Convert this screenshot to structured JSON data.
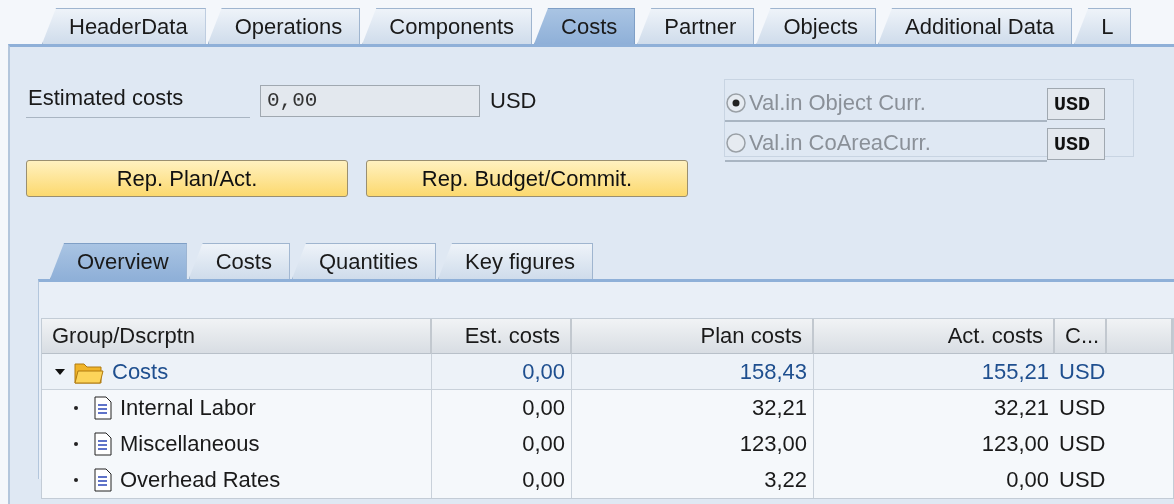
{
  "tabs": [
    {
      "label": "HeaderData",
      "selected": false
    },
    {
      "label": "Operations",
      "selected": false
    },
    {
      "label": "Components",
      "selected": false
    },
    {
      "label": "Costs",
      "selected": true
    },
    {
      "label": "Partner",
      "selected": false
    },
    {
      "label": "Objects",
      "selected": false
    },
    {
      "label": "Additional Data",
      "selected": false
    },
    {
      "label": "L",
      "selected": false
    }
  ],
  "estimated_costs": {
    "label": "Estimated costs",
    "value": "0,00",
    "currency": "USD"
  },
  "valuation": [
    {
      "label": "Val.in Object Curr.",
      "selected": true,
      "disabled": true,
      "currency": "USD"
    },
    {
      "label": "Val.in CoAreaCurr.",
      "selected": false,
      "disabled": true,
      "currency": "USD"
    }
  ],
  "buttons": [
    "Rep. Plan/Act.",
    "Rep. Budget/Commit."
  ],
  "subtabs": [
    {
      "label": "Overview",
      "selected": true
    },
    {
      "label": "Costs",
      "selected": false
    },
    {
      "label": "Quantities",
      "selected": false
    },
    {
      "label": "Key figures",
      "selected": false
    }
  ],
  "table": {
    "columns": [
      "Group/Dscrptn",
      "Est. costs",
      "Plan costs",
      "Act. costs",
      "C..."
    ],
    "rows": [
      {
        "label": "Costs",
        "expanded": true,
        "est": "0,00",
        "plan": "158,43",
        "act": "155,21",
        "currency": "USD",
        "children": [
          {
            "label": "Internal Labor",
            "est": "0,00",
            "plan": "32,21",
            "act": "32,21",
            "currency": "USD"
          },
          {
            "label": "Miscellaneous",
            "est": "0,00",
            "plan": "123,00",
            "act": "123,00",
            "currency": "USD"
          },
          {
            "label": "Overhead Rates",
            "est": "0,00",
            "plan": "3,22",
            "act": "0,00",
            "currency": "USD"
          }
        ]
      }
    ]
  }
}
